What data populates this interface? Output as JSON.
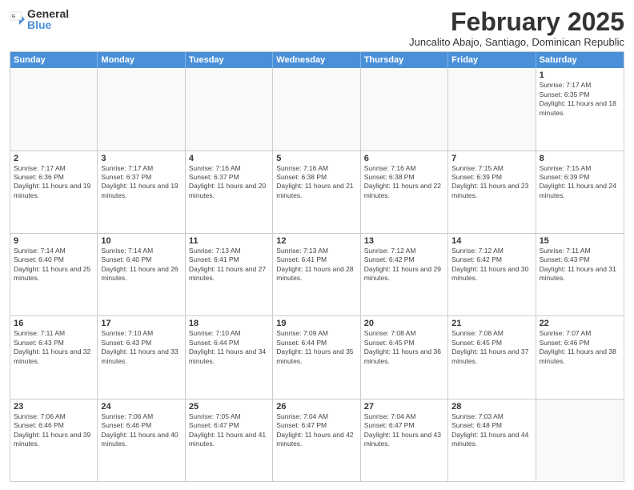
{
  "logo": {
    "general": "General",
    "blue": "Blue"
  },
  "title": "February 2025",
  "subtitle": "Juncalito Abajo, Santiago, Dominican Republic",
  "header_days": [
    "Sunday",
    "Monday",
    "Tuesday",
    "Wednesday",
    "Thursday",
    "Friday",
    "Saturday"
  ],
  "weeks": [
    [
      {
        "day": "",
        "info": ""
      },
      {
        "day": "",
        "info": ""
      },
      {
        "day": "",
        "info": ""
      },
      {
        "day": "",
        "info": ""
      },
      {
        "day": "",
        "info": ""
      },
      {
        "day": "",
        "info": ""
      },
      {
        "day": "1",
        "info": "Sunrise: 7:17 AM\nSunset: 6:35 PM\nDaylight: 11 hours and 18 minutes."
      }
    ],
    [
      {
        "day": "2",
        "info": "Sunrise: 7:17 AM\nSunset: 6:36 PM\nDaylight: 11 hours and 19 minutes."
      },
      {
        "day": "3",
        "info": "Sunrise: 7:17 AM\nSunset: 6:37 PM\nDaylight: 11 hours and 19 minutes."
      },
      {
        "day": "4",
        "info": "Sunrise: 7:16 AM\nSunset: 6:37 PM\nDaylight: 11 hours and 20 minutes."
      },
      {
        "day": "5",
        "info": "Sunrise: 7:16 AM\nSunset: 6:38 PM\nDaylight: 11 hours and 21 minutes."
      },
      {
        "day": "6",
        "info": "Sunrise: 7:16 AM\nSunset: 6:38 PM\nDaylight: 11 hours and 22 minutes."
      },
      {
        "day": "7",
        "info": "Sunrise: 7:15 AM\nSunset: 6:39 PM\nDaylight: 11 hours and 23 minutes."
      },
      {
        "day": "8",
        "info": "Sunrise: 7:15 AM\nSunset: 6:39 PM\nDaylight: 11 hours and 24 minutes."
      }
    ],
    [
      {
        "day": "9",
        "info": "Sunrise: 7:14 AM\nSunset: 6:40 PM\nDaylight: 11 hours and 25 minutes."
      },
      {
        "day": "10",
        "info": "Sunrise: 7:14 AM\nSunset: 6:40 PM\nDaylight: 11 hours and 26 minutes."
      },
      {
        "day": "11",
        "info": "Sunrise: 7:13 AM\nSunset: 6:41 PM\nDaylight: 11 hours and 27 minutes."
      },
      {
        "day": "12",
        "info": "Sunrise: 7:13 AM\nSunset: 6:41 PM\nDaylight: 11 hours and 28 minutes."
      },
      {
        "day": "13",
        "info": "Sunrise: 7:12 AM\nSunset: 6:42 PM\nDaylight: 11 hours and 29 minutes."
      },
      {
        "day": "14",
        "info": "Sunrise: 7:12 AM\nSunset: 6:42 PM\nDaylight: 11 hours and 30 minutes."
      },
      {
        "day": "15",
        "info": "Sunrise: 7:11 AM\nSunset: 6:43 PM\nDaylight: 11 hours and 31 minutes."
      }
    ],
    [
      {
        "day": "16",
        "info": "Sunrise: 7:11 AM\nSunset: 6:43 PM\nDaylight: 11 hours and 32 minutes."
      },
      {
        "day": "17",
        "info": "Sunrise: 7:10 AM\nSunset: 6:43 PM\nDaylight: 11 hours and 33 minutes."
      },
      {
        "day": "18",
        "info": "Sunrise: 7:10 AM\nSunset: 6:44 PM\nDaylight: 11 hours and 34 minutes."
      },
      {
        "day": "19",
        "info": "Sunrise: 7:09 AM\nSunset: 6:44 PM\nDaylight: 11 hours and 35 minutes."
      },
      {
        "day": "20",
        "info": "Sunrise: 7:08 AM\nSunset: 6:45 PM\nDaylight: 11 hours and 36 minutes."
      },
      {
        "day": "21",
        "info": "Sunrise: 7:08 AM\nSunset: 6:45 PM\nDaylight: 11 hours and 37 minutes."
      },
      {
        "day": "22",
        "info": "Sunrise: 7:07 AM\nSunset: 6:46 PM\nDaylight: 11 hours and 38 minutes."
      }
    ],
    [
      {
        "day": "23",
        "info": "Sunrise: 7:06 AM\nSunset: 6:46 PM\nDaylight: 11 hours and 39 minutes."
      },
      {
        "day": "24",
        "info": "Sunrise: 7:06 AM\nSunset: 6:46 PM\nDaylight: 11 hours and 40 minutes."
      },
      {
        "day": "25",
        "info": "Sunrise: 7:05 AM\nSunset: 6:47 PM\nDaylight: 11 hours and 41 minutes."
      },
      {
        "day": "26",
        "info": "Sunrise: 7:04 AM\nSunset: 6:47 PM\nDaylight: 11 hours and 42 minutes."
      },
      {
        "day": "27",
        "info": "Sunrise: 7:04 AM\nSunset: 6:47 PM\nDaylight: 11 hours and 43 minutes."
      },
      {
        "day": "28",
        "info": "Sunrise: 7:03 AM\nSunset: 6:48 PM\nDaylight: 11 hours and 44 minutes."
      },
      {
        "day": "",
        "info": ""
      }
    ]
  ]
}
